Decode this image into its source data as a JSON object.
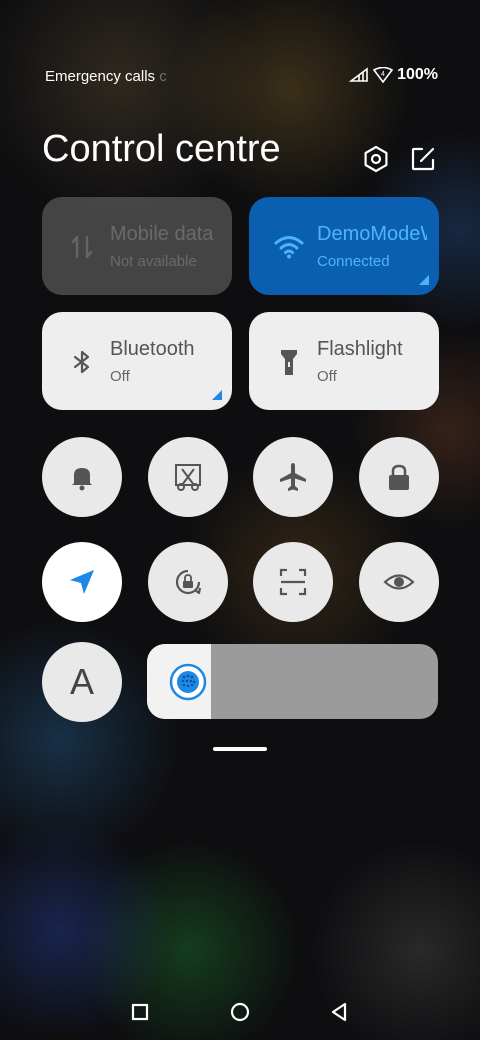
{
  "status_bar": {
    "emergency_text": "Emergency calls",
    "emergency_fade": "c",
    "battery": "100%"
  },
  "header": {
    "title": "Control centre"
  },
  "tiles": {
    "mobile_data": {
      "title": "Mobile data",
      "subtitle": "Not available"
    },
    "wifi": {
      "title": "DemoModeWiFi",
      "subtitle": "Connected"
    },
    "bluetooth": {
      "title": "Bluetooth",
      "subtitle": "Off"
    },
    "flashlight": {
      "title": "Flashlight",
      "subtitle": "Off"
    }
  },
  "toggles": {
    "font_letter": "A"
  },
  "brightness": {
    "level": 0.22
  },
  "colors": {
    "accent": "#1e88e5",
    "wifi_tile": "#0b5fb0",
    "wifi_text": "#4db3ff"
  },
  "icons": [
    "settings-hexagon-icon",
    "edit-icon",
    "mobile-data-icon",
    "wifi-icon",
    "bluetooth-icon",
    "flashlight-icon",
    "bell-icon",
    "screenshot-icon",
    "airplane-icon",
    "lock-icon",
    "location-icon",
    "rotation-lock-icon",
    "scanner-icon",
    "eye-icon",
    "brightness-icon"
  ]
}
